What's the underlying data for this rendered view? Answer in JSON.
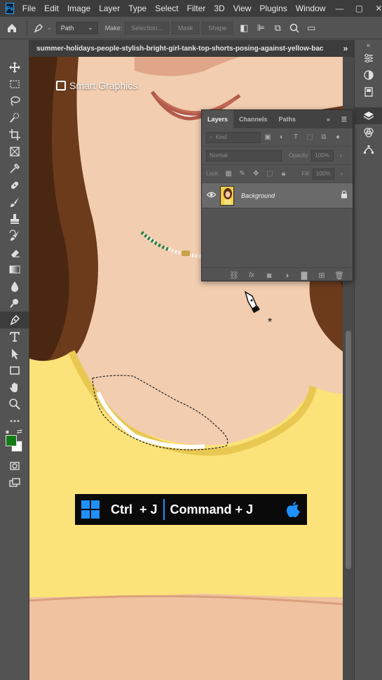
{
  "app": {
    "logo": "Ps",
    "menu": [
      "File",
      "Edit",
      "Image",
      "Layer",
      "Type",
      "Select",
      "Filter",
      "3D",
      "View",
      "Plugins",
      "Window"
    ],
    "window_controls": [
      "minimize-icon",
      "restore-icon",
      "close-icon"
    ]
  },
  "options_bar": {
    "mode_value": "Path",
    "make_label": "Make:",
    "selection_button": "Selection...",
    "mask_button": "Mask",
    "shape_button": "Shape"
  },
  "document": {
    "tab_title": "summer-holidays-people-stylish-bright-girl-tank-top-shorts-posing-against-yellow-bac"
  },
  "tools": [
    "move-icon",
    "marquee-icon",
    "lasso-icon",
    "quick-select-icon",
    "crop-icon",
    "frame-icon",
    "eyedropper-icon",
    "healing-icon",
    "brush-icon",
    "stamp-icon",
    "history-brush-icon",
    "eraser-icon",
    "gradient-icon",
    "blur-icon",
    "dodge-icon",
    "pen-icon",
    "type-icon",
    "path-select-icon",
    "rectangle-icon",
    "hand-icon",
    "zoom-icon",
    "more-tools-icon"
  ],
  "colors": {
    "foreground": "#117d14",
    "background": "#ffffff",
    "accent": "#1e90ff"
  },
  "layers_panel": {
    "tabs": [
      "Layers",
      "Channels",
      "Paths"
    ],
    "active_tab": "Layers",
    "filter_placeholder": "Kind",
    "blend_mode": "Normal",
    "opacity_label": "Opacity:",
    "opacity_value": "100%",
    "lock_label": "Lock:",
    "fill_label": "Fill:",
    "fill_value": "100%",
    "layers": [
      {
        "name": "Background",
        "visible": true,
        "locked": true
      }
    ]
  },
  "overlay": {
    "brand": "Smart Graphics",
    "shortcut_windows": "Ctrl  + J",
    "shortcut_mac": "Command + J"
  }
}
